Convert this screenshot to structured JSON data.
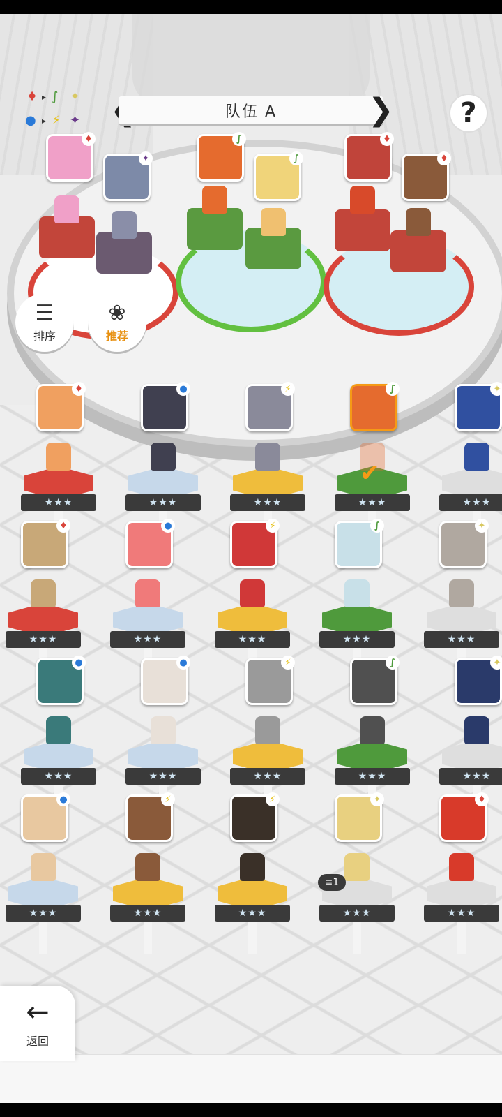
{
  "header": {
    "team_title": "队伍 A",
    "help_label": "?"
  },
  "legend": {
    "row1": [
      "♦",
      "▸",
      "∫",
      "✦"
    ],
    "row2": [
      "●",
      "▸",
      "⚡",
      "✦"
    ]
  },
  "buttons": {
    "sort_label": "排序",
    "recommend_label": "推荐",
    "back_label": "返回"
  },
  "colors": {
    "red": "#d9443a",
    "purple": "#6b5a70",
    "green": "#4f9a3c",
    "blue": "#c6d8ea",
    "yellow": "#efbd3c",
    "white": "#dedede",
    "accent": "#f59a16"
  },
  "element_icons": {
    "fire": "♦",
    "leaf": "∫",
    "water": "●",
    "thunder": "⚡",
    "light": "✦",
    "dark": "✦"
  },
  "team_slots": [
    {
      "element": "fire",
      "color": "#f0a0c8"
    },
    {
      "element": "dark",
      "color": "#7d8aa8"
    },
    {
      "element": "leaf",
      "color": "#e56b2e"
    },
    {
      "element": "leaf",
      "color": "#f0d47a"
    },
    {
      "element": "fire",
      "color": "#c0443a"
    },
    {
      "element": "fire",
      "color": "#8a5a3a"
    }
  ],
  "roster": [
    {
      "element": "fire",
      "stars": "★★★",
      "color": "#f0a060",
      "pedestal": "red"
    },
    {
      "element": "water",
      "stars": "★★★",
      "color": "#404050",
      "pedestal": "blue"
    },
    {
      "element": "thunder",
      "stars": "★★★",
      "color": "#8a8a9a",
      "pedestal": "yellow"
    },
    {
      "element": "leaf",
      "stars": "★★★",
      "color": "#e56b2e",
      "pedestal": "green",
      "selected": true
    },
    {
      "element": "light",
      "stars": "★★★",
      "color": "#3050a0",
      "pedestal": "white"
    },
    {
      "element": "fire",
      "stars": "★★★",
      "color": "#c8a878",
      "pedestal": "red"
    },
    {
      "element": "water",
      "stars": "★★★",
      "color": "#f07a7a",
      "pedestal": "blue"
    },
    {
      "element": "thunder",
      "stars": "★★★",
      "color": "#d03838",
      "pedestal": "yellow"
    },
    {
      "element": "leaf",
      "stars": "★★★",
      "color": "#c8e0e8",
      "pedestal": "green"
    },
    {
      "element": "light",
      "stars": "★★★",
      "color": "#b0a8a0",
      "pedestal": "white"
    },
    {
      "element": "water",
      "stars": "★★★",
      "color": "#3a7a7a",
      "pedestal": "blue"
    },
    {
      "element": "water",
      "stars": "★★★",
      "color": "#e8e0d8",
      "pedestal": "blue"
    },
    {
      "element": "thunder",
      "stars": "★★★",
      "color": "#9a9a9a",
      "pedestal": "yellow"
    },
    {
      "element": "leaf",
      "stars": "★★★",
      "color": "#505050",
      "pedestal": "green"
    },
    {
      "element": "light",
      "stars": "★★★",
      "color": "#2a3a6a",
      "pedestal": "white"
    },
    {
      "element": "water",
      "stars": "★★★",
      "color": "#e8c8a0",
      "pedestal": "blue"
    },
    {
      "element": "thunder",
      "stars": "★★★",
      "color": "#8a5a3a",
      "pedestal": "yellow"
    },
    {
      "element": "thunder",
      "stars": "★★★",
      "color": "#3a3028",
      "pedestal": "yellow"
    },
    {
      "element": "light",
      "stars": "★★★",
      "color": "#e8d080",
      "pedestal": "white",
      "count": "1"
    },
    {
      "element": "fire",
      "stars": "★★★",
      "color": "#d83a2a",
      "pedestal": "white"
    }
  ],
  "count_pill_text": "≡1"
}
